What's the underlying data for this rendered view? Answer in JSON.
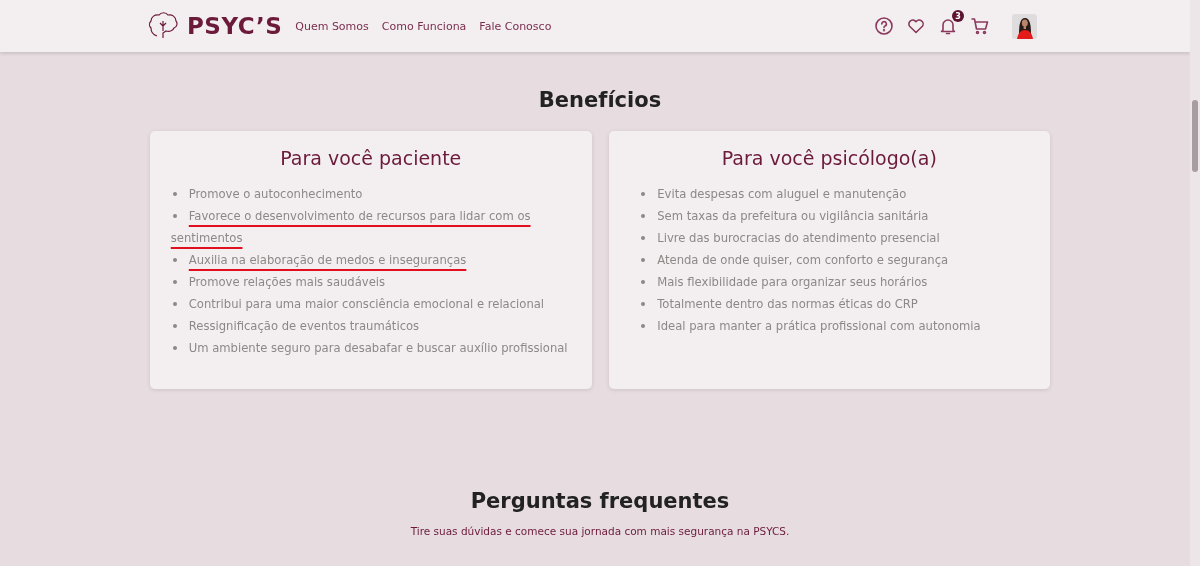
{
  "header": {
    "logo": "PSYC’S",
    "nav": [
      "Quem Somos",
      "Como Funciona",
      "Fale Conosco"
    ],
    "notification_count": "3"
  },
  "benefits": {
    "title": "Benefícios",
    "cards": [
      {
        "title": "Para você paciente",
        "items": [
          {
            "text": "Promove o autoconhecimento",
            "underlined": false
          },
          {
            "text": "Favorece o desenvolvimento de recursos para lidar com os sentimentos",
            "underlined": true
          },
          {
            "text": "Auxilia na elaboração de medos e inseguranças",
            "underlined": true
          },
          {
            "text": "Promove relações mais saudáveis",
            "underlined": false
          },
          {
            "text": "Contribui para uma maior consciência emocional e relacional",
            "underlined": false
          },
          {
            "text": "Ressignificação de eventos traumáticos",
            "underlined": false
          },
          {
            "text": "Um ambiente seguro para desabafar e buscar auxílio profissional",
            "underlined": false
          }
        ]
      },
      {
        "title": "Para você psicólogo(a)",
        "items": [
          {
            "text": "Evita despesas com aluguel e manutenção",
            "underlined": false
          },
          {
            "text": "Sem taxas da prefeitura ou vigilância sanitária",
            "underlined": false
          },
          {
            "text": "Livre das burocracias do atendimento presencial",
            "underlined": false
          },
          {
            "text": "Atenda de onde quiser, com conforto e segurança",
            "underlined": false
          },
          {
            "text": "Mais flexibilidade para organizar seus horários",
            "underlined": false
          },
          {
            "text": "Totalmente dentro das normas éticas do CRP",
            "underlined": false
          },
          {
            "text": "Ideal para manter a prática profissional com autonomia",
            "underlined": false
          }
        ]
      }
    ]
  },
  "faq": {
    "title": "Perguntas frequentes",
    "subtitle": "Tire suas dúvidas e comece sua jornada com mais segurança na PSYCS."
  }
}
